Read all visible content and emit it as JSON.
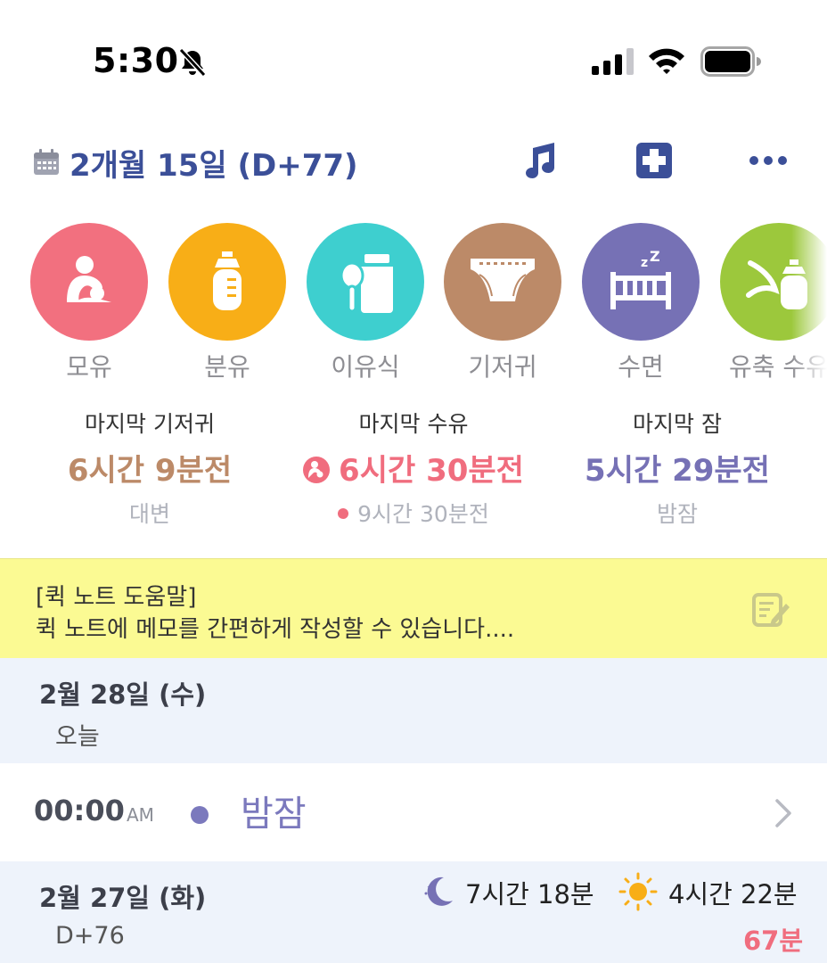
{
  "status_bar": {
    "time": "5:30"
  },
  "header": {
    "date_title": "2개월 15일 (D+77)"
  },
  "categories": [
    {
      "label": "모유",
      "color": "#f2707f",
      "icon": "breastfeeding-icon"
    },
    {
      "label": "분유",
      "color": "#f8ae17",
      "icon": "bottle-icon"
    },
    {
      "label": "이유식",
      "color": "#3ecfcf",
      "icon": "baby-food-icon"
    },
    {
      "label": "기저귀",
      "color": "#bc8a68",
      "icon": "diaper-icon"
    },
    {
      "label": "수면",
      "color": "#7671b5",
      "icon": "crib-sleep-icon"
    },
    {
      "label": "유축 수유",
      "color": "#9cc83c",
      "icon": "pumped-bottle-icon"
    }
  ],
  "last_stats": {
    "diaper": {
      "title": "마지막 기저귀",
      "value": "6시간 9분전",
      "sub": "대변",
      "color": "#bc8a68"
    },
    "feeding": {
      "title": "마지막 수유",
      "value": "6시간 30분전",
      "sub": "9시간 30분전",
      "color": "#f06d7e"
    },
    "sleep": {
      "title": "마지막 잠",
      "value": "5시간 29분전",
      "sub": "밤잠",
      "color": "#7671b5"
    }
  },
  "quick_note": {
    "title": "[퀵 노트 도움말]",
    "text": "퀵 노트에 메모를 간편하게 작성할 수 있습니다...."
  },
  "days": [
    {
      "date": "2월 28일 (수)",
      "sub": "오늘",
      "records": [
        {
          "time": "00:00",
          "ampm": "AM",
          "label": "밤잠",
          "color": "#7b79bd"
        }
      ]
    },
    {
      "date": "2월 27일 (화)",
      "sub": "D+76",
      "night_sleep": "7시간 18분",
      "day_sleep": "4시간 22분",
      "minutes": "67분"
    }
  ]
}
